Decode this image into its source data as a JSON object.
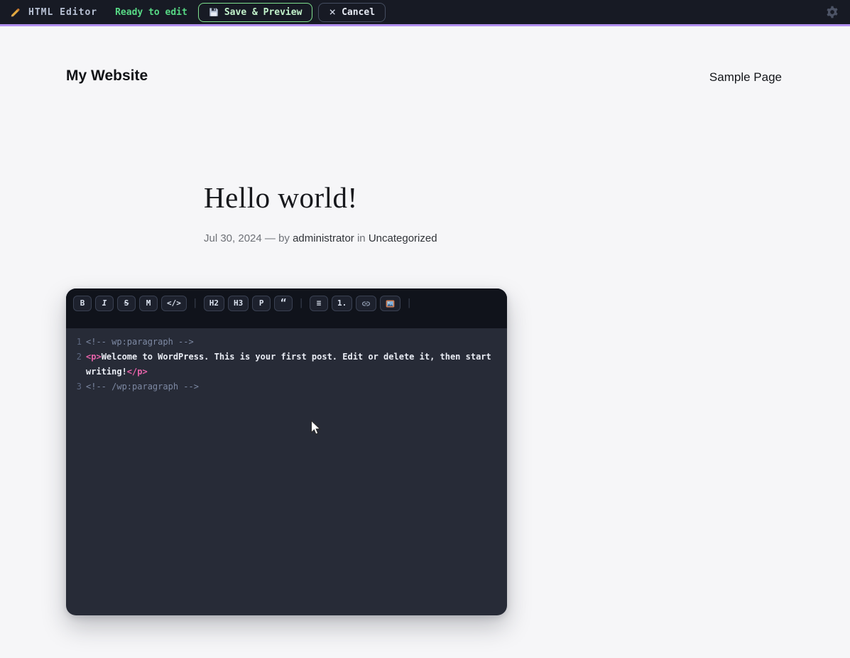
{
  "colors": {
    "topbar-bg": "#171a24",
    "accent-purple": "#b18ff0",
    "status-green": "#57d985",
    "save-border": "#7fe08e",
    "save-text": "#c2f3cb",
    "toolbar-bg": "#10131b",
    "code-bg": "#272b37",
    "tag-pink": "#e763aa",
    "comment-gray": "#7d89a3"
  },
  "topbar": {
    "title": "HTML Editor",
    "status": "Ready to edit",
    "save_label": "Save & Preview",
    "cancel_label": "Cancel",
    "close_glyph": "×"
  },
  "site": {
    "title": "My Website",
    "nav_link": "Sample Page"
  },
  "post": {
    "title": "Hello world!",
    "meta": {
      "date": "Jul 30, 2024",
      "dash": "—",
      "by_label": "by",
      "author": "administrator",
      "in_label": "in",
      "category": "Uncategorized"
    }
  },
  "editor": {
    "toolbar_groups": [
      [
        {
          "label": "B",
          "name": "bold"
        },
        {
          "label": "I",
          "name": "italic"
        },
        {
          "label": "S",
          "name": "strikethrough"
        },
        {
          "label": "M",
          "name": "monospace"
        },
        {
          "label": "</>",
          "name": "code"
        }
      ],
      [
        {
          "label": "H2",
          "name": "heading2"
        },
        {
          "label": "H3",
          "name": "heading3"
        },
        {
          "label": "P",
          "name": "paragraph"
        },
        {
          "label": "“",
          "name": "blockquote"
        }
      ],
      [
        {
          "label": "≡",
          "name": "unordered-list"
        },
        {
          "label": "1.",
          "name": "ordered-list"
        },
        {
          "name": "link",
          "icon": "link-icon"
        },
        {
          "name": "image",
          "icon": "image-icon"
        }
      ]
    ],
    "code_lines": [
      {
        "num": "1",
        "segments": [
          {
            "text": "<!-- wp:paragraph -->",
            "type": "comment"
          }
        ]
      },
      {
        "num": "2",
        "segments": [
          {
            "text": "<p>",
            "type": "tag"
          },
          {
            "text": "Welcome to WordPress. This is your first post. Edit or delete it, then start writing!",
            "type": "plain"
          },
          {
            "text": "</p>",
            "type": "tag"
          }
        ]
      },
      {
        "num": "3",
        "segments": [
          {
            "text": "<!-- /wp:paragraph -->",
            "type": "comment"
          }
        ]
      }
    ]
  }
}
